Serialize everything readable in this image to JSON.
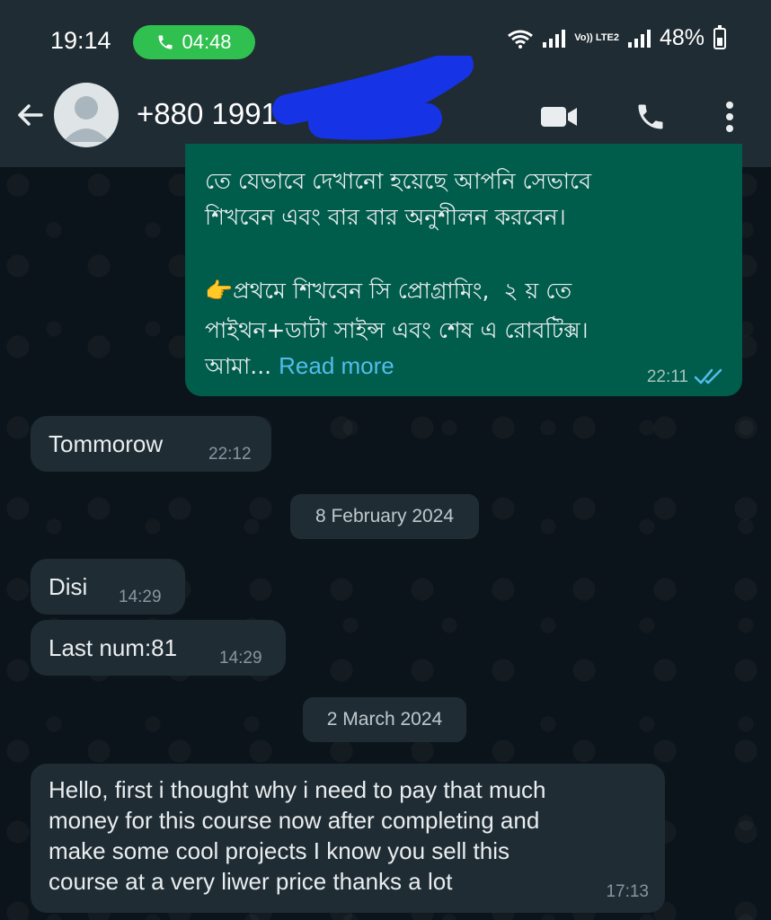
{
  "status_bar": {
    "time": "19:14",
    "call_timer": "04:48",
    "network": "Vo)) LTE2",
    "battery": "48%"
  },
  "header": {
    "contact": "+880 1991",
    "icons": [
      "back-arrow-icon",
      "avatar-icon",
      "video-call-icon",
      "voice-call-icon",
      "more-icon"
    ]
  },
  "messages": [
    {
      "direction": "outgoing",
      "lines": [
        "তে যেভাবে দেখানো হয়েছে আপনি সেভাবে",
        "শিখবেন এবং বার বার অনুশীলন করবেন।",
        "",
        "👉প্রথমে শিখবেন সি প্রোগ্রামিং,  ২ য় তে",
        "পাইথন+ডাটা সাইন্স এবং শেষ এ রোবটিক্স।"
      ],
      "last_line": "আমা...",
      "read_more": "Read more",
      "time": "22:11",
      "status": "read"
    },
    {
      "direction": "incoming",
      "text": "Tommorow",
      "time": "22:12"
    },
    {
      "type": "date",
      "text": "8 February 2024"
    },
    {
      "direction": "incoming",
      "text": "Disi",
      "time": "14:29"
    },
    {
      "direction": "incoming",
      "text": "Last num:81",
      "time": "14:29"
    },
    {
      "type": "date",
      "text": "2 March 2024"
    },
    {
      "direction": "incoming",
      "lines": [
        "Hello, first i thought why i need to pay that much",
        "money for this course now after completing and",
        "make some cool projects I know you sell this",
        "course at a very liwer price thanks a lot"
      ],
      "time": "17:13"
    }
  ],
  "colors": {
    "header_bg": "#1f2c34",
    "chat_bg": "#0b141a",
    "outgoing_bubble": "#005c4b",
    "incoming_bubble": "#1f2c34",
    "call_pill": "#30c04f",
    "read_ticks": "#53bdeb"
  }
}
